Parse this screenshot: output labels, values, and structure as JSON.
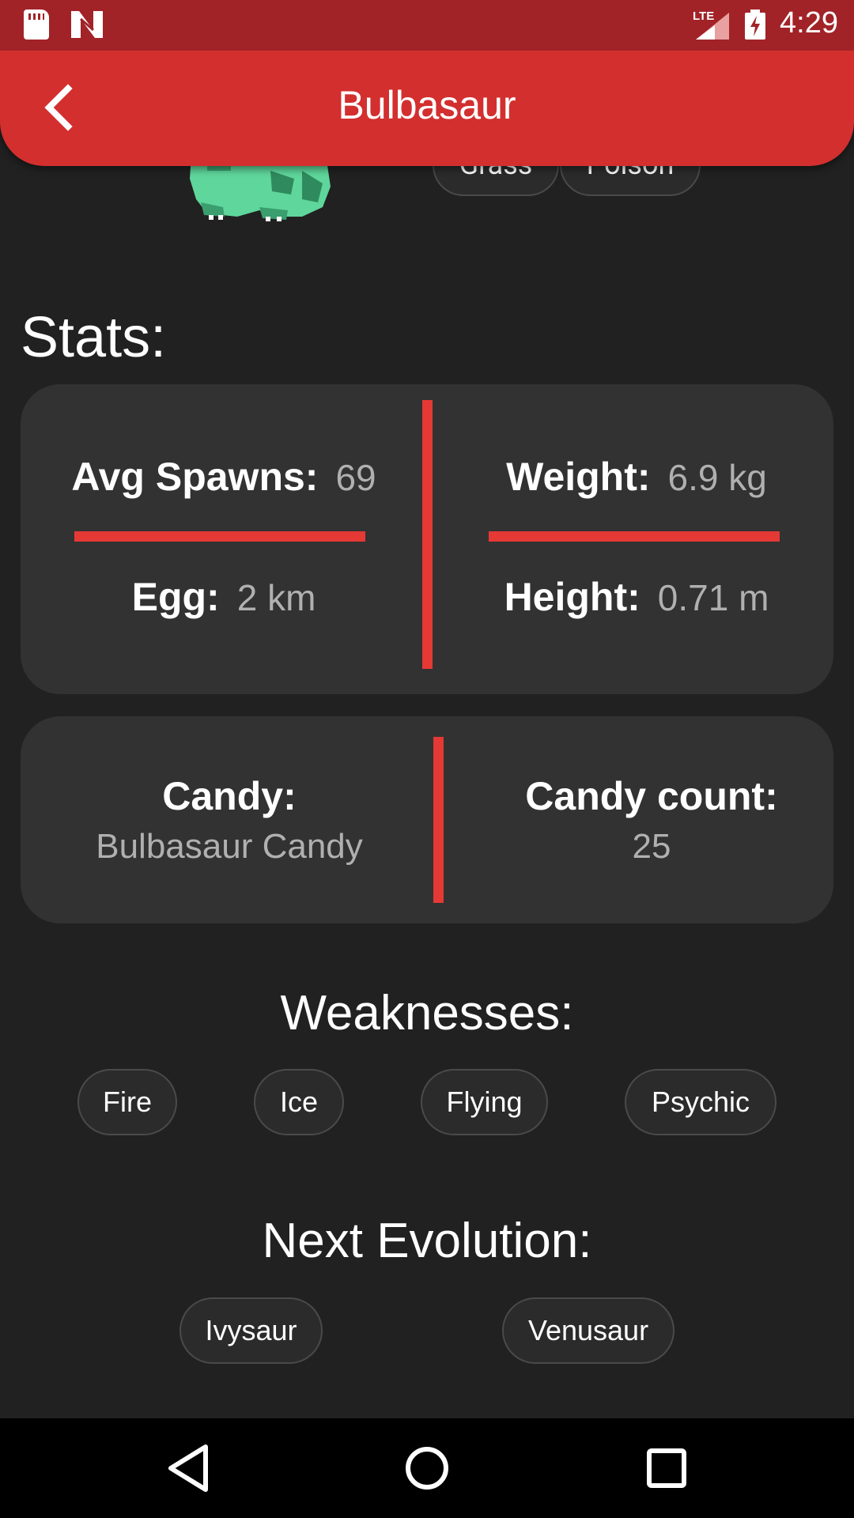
{
  "status_bar": {
    "time": "4:29",
    "network": "LTE",
    "icons": [
      "sd-card-icon",
      "n-notification-icon",
      "signal-icon",
      "battery-charging-icon"
    ]
  },
  "app_bar": {
    "title": "Bulbasaur",
    "back_icon": "chevron-left-icon"
  },
  "header": {
    "types": [
      "Grass",
      "Poison"
    ]
  },
  "stats": {
    "heading": "Stats:",
    "avg_spawns": {
      "label": "Avg Spawns:",
      "value": "69"
    },
    "egg": {
      "label": "Egg:",
      "value": "2 km"
    },
    "weight": {
      "label": "Weight:",
      "value": "6.9 kg"
    },
    "height": {
      "label": "Height:",
      "value": "0.71 m"
    }
  },
  "candy": {
    "candy": {
      "label": "Candy:",
      "value": "Bulbasaur Candy"
    },
    "count": {
      "label": "Candy count:",
      "value": "25"
    }
  },
  "weaknesses": {
    "title": "Weaknesses:",
    "items": [
      "Fire",
      "Ice",
      "Flying",
      "Psychic"
    ]
  },
  "next_evolution": {
    "title": "Next Evolution:",
    "items": [
      "Ivysaur",
      "Venusaur"
    ]
  },
  "colors": {
    "accent": "#d32f2f",
    "status_bar": "#a12327",
    "background": "#212121",
    "card": "#323232",
    "divider": "#e53935"
  },
  "nav_bar": {
    "icons": [
      "back-triangle-icon",
      "home-circle-icon",
      "recents-square-icon"
    ]
  }
}
